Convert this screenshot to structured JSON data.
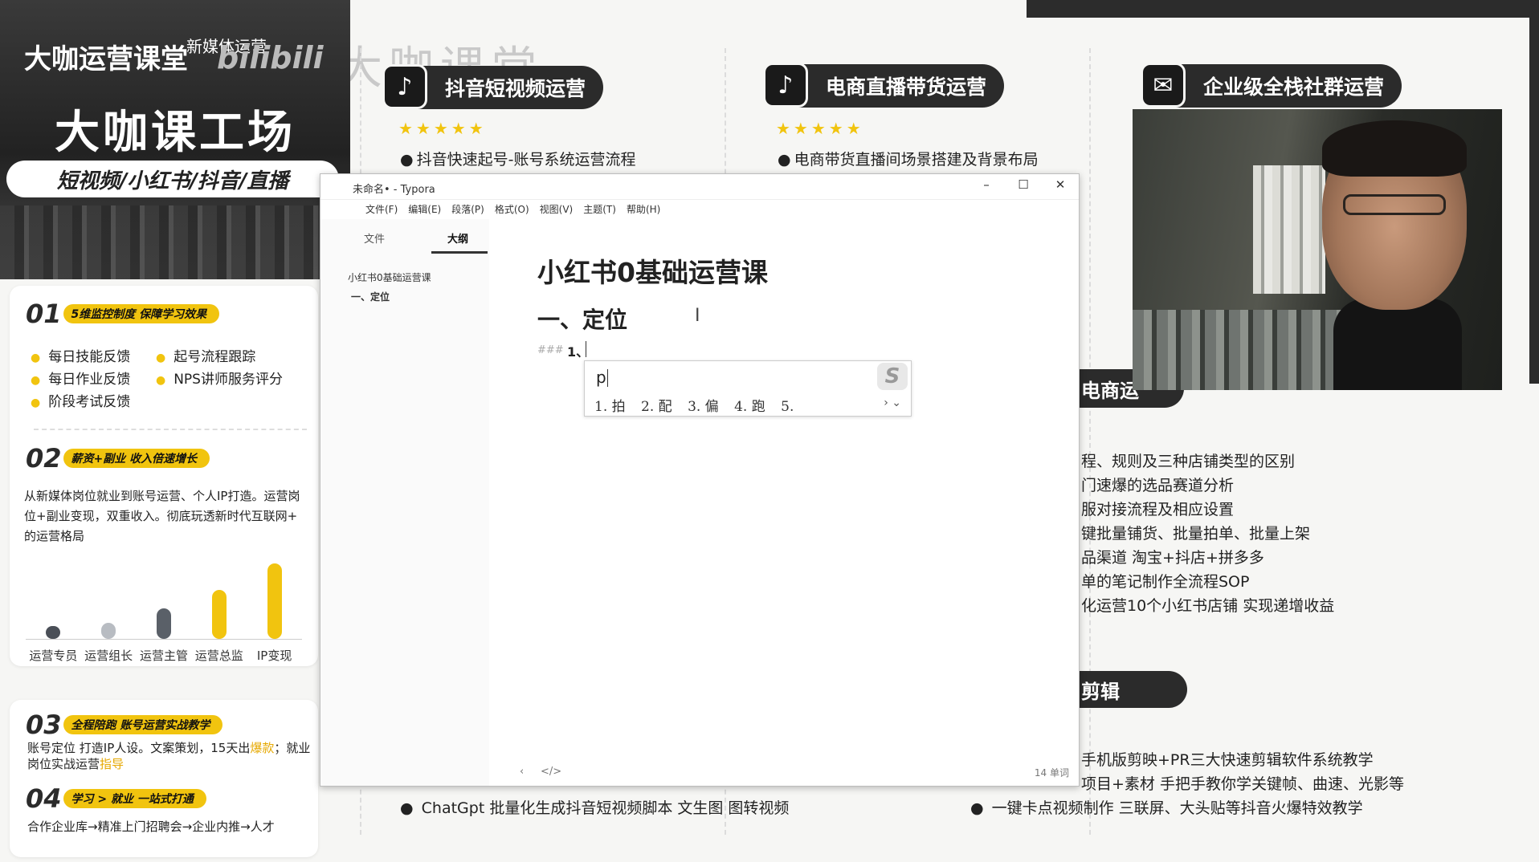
{
  "background": {
    "watermark": "大咖课堂",
    "categories": [
      {
        "icon": "tiktok-icon",
        "label": "抖音短视频运营",
        "stars": "★★★★★",
        "bullet": "抖音快速起号-账号系统运营流程"
      },
      {
        "icon": "tiktok-icon",
        "label": "电商直播带货运营",
        "stars": "★★★★★",
        "bullet": "电商带货直播间场景搭建及背景布局"
      },
      {
        "icon": "wechat-icon",
        "label": "企业级全栈社群运营"
      }
    ],
    "ecommerce_partial_label": "电商运",
    "ecommerce_list": [
      "程、规则及三种店铺类型的区别",
      "门速爆的选品赛道分析",
      "服对接流程及相应设置",
      "键批量铺货、批量拍单、批量上架",
      "品渠道 淘宝+抖店+拼多多",
      "单的笔记制作全流程SOP",
      "化运营10个小红书店铺 实现递增收益"
    ],
    "edit_partial_label": "剪辑",
    "edit_list": [
      "手机版剪映+PR三大快速剪辑软件系统教学",
      "项目+素材 手把手教你学关键帧、曲速、光影等",
      "一键卡点视频制作 三联屏、大头贴等抖音火爆特效教学"
    ],
    "bottom_bullet": "ChatGpt 批量化生成抖音短视频脚本 文生图 图转视频"
  },
  "left_panel": {
    "brand": "大咖运营课堂",
    "brand_sub": "新媒体运营",
    "brand_logo": "bilibili",
    "title": "大咖课工场",
    "subtitle": "短视频/小红书/抖音/直播",
    "sec1": {
      "num": "01",
      "label": "5维监控制度 保障学习效果",
      "items": [
        "每日技能反馈",
        "起号流程跟踪",
        "每日作业反馈",
        "NPS讲师服务评分",
        "阶段考试反馈"
      ]
    },
    "sec2": {
      "num": "02",
      "label": "薪资+副业 收入倍速增长",
      "text": "从新媒体岗位就业到账号运营、个人IP打造。运营岗位+副业变现，双重收入。彻底玩透新时代互联网+ 的运营格局",
      "chart_data": {
        "type": "bar",
        "categories": [
          "运营专员",
          "运营组长",
          "运营主管",
          "运营总监",
          "IP变现"
        ],
        "values": [
          1,
          1.4,
          2.6,
          4.2,
          6.5
        ],
        "colors": [
          "#4a4f57",
          "#b8bcc2",
          "#5a6068",
          "#f1c40f",
          "#f1c40f"
        ]
      }
    },
    "sec3": {
      "num": "03",
      "label": "全程陪跑 账号运营实战教学",
      "text_a": "账号定位 打造IP人设。文案策划，15天出",
      "text_hl1": "爆款",
      "text_b": "；就业岗位实战运营",
      "text_hl2": "指导"
    },
    "sec4": {
      "num": "04",
      "label": "学习 > 就业 一站式打通",
      "text": "合作企业库→精准上门招聘会→企业内推→人才"
    }
  },
  "typora": {
    "window_title": "未命名• - Typora",
    "menu": [
      "文件(F)",
      "编辑(E)",
      "段落(P)",
      "格式(O)",
      "视图(V)",
      "主题(T)",
      "帮助(H)"
    ],
    "tabs": {
      "files": "文件",
      "outline": "大纲"
    },
    "outline": [
      "小红书0基础运营课",
      "一、定位"
    ],
    "h1": "小红书0基础运营课",
    "h2": "一、定位",
    "md_marker": "###",
    "current_line": "1、",
    "word_count": "14 单词",
    "bottom_icons": {
      "back": "‹",
      "source": "</>"
    }
  },
  "ime": {
    "input": "p",
    "candidates": [
      "1. 拍",
      "2. 配",
      "3. 偏",
      "4. 跑",
      "5."
    ],
    "logo": "S",
    "nav": "›  ⌄"
  },
  "webcam": {
    "alt": ""
  }
}
